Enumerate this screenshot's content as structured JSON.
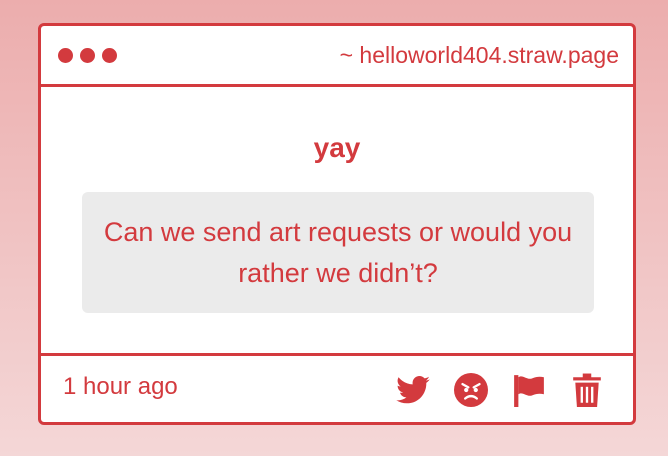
{
  "window": {
    "url": "~ helloworld404.straw.page"
  },
  "post": {
    "answer": "yay",
    "question": "Can we send art requests or would you rather we didn’t?",
    "time": "1 hour ago"
  },
  "actions": [
    {
      "icon": "twitter-icon"
    },
    {
      "icon": "angry-face-icon"
    },
    {
      "icon": "flag-icon"
    },
    {
      "icon": "trash-icon"
    }
  ],
  "colors": {
    "accent": "#d33a3e",
    "question_bg": "#ebebeb",
    "bg_top": "#ecadad",
    "bg_bottom": "#f4d7d7"
  }
}
